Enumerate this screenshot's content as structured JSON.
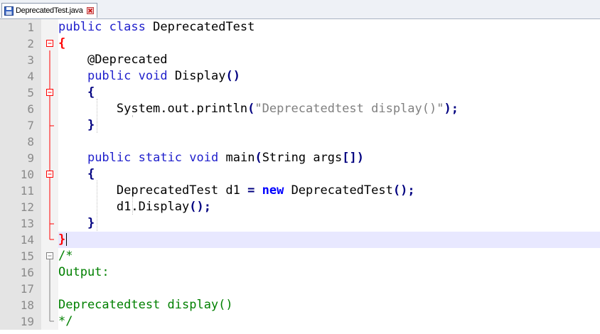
{
  "tab": {
    "label": "DeprecatedTest.java"
  },
  "lines": [
    {
      "num": "1",
      "tokens": [
        [
          "kw",
          "public"
        ],
        [
          "pl",
          " "
        ],
        [
          "kw",
          "class"
        ],
        [
          "pl",
          " DeprecatedTest"
        ]
      ]
    },
    {
      "num": "2",
      "tokens": [
        [
          "redbr",
          "{"
        ]
      ]
    },
    {
      "num": "3",
      "tokens": [
        [
          "pl",
          "    "
        ],
        [
          "ann",
          "@Deprecated"
        ]
      ]
    },
    {
      "num": "4",
      "tokens": [
        [
          "pl",
          "    "
        ],
        [
          "kw",
          "public"
        ],
        [
          "pl",
          " "
        ],
        [
          "kw",
          "void"
        ],
        [
          "pl",
          " Display"
        ],
        [
          "op",
          "()"
        ]
      ]
    },
    {
      "num": "5",
      "tokens": [
        [
          "pl",
          "    "
        ],
        [
          "op",
          "{"
        ]
      ]
    },
    {
      "num": "6",
      "tokens": [
        [
          "pl",
          "        System.out.println"
        ],
        [
          "op",
          "("
        ],
        [
          "str",
          "\"Deprecatedtest display()\""
        ],
        [
          "op",
          ");"
        ]
      ]
    },
    {
      "num": "7",
      "tokens": [
        [
          "pl",
          "    "
        ],
        [
          "op",
          "}"
        ]
      ]
    },
    {
      "num": "8",
      "tokens": []
    },
    {
      "num": "9",
      "tokens": [
        [
          "pl",
          "    "
        ],
        [
          "kw",
          "public"
        ],
        [
          "pl",
          " "
        ],
        [
          "kw",
          "static"
        ],
        [
          "pl",
          " "
        ],
        [
          "kw",
          "void"
        ],
        [
          "pl",
          " main"
        ],
        [
          "op",
          "("
        ],
        [
          "pl",
          "String args"
        ],
        [
          "op",
          "[])"
        ]
      ]
    },
    {
      "num": "10",
      "tokens": [
        [
          "pl",
          "    "
        ],
        [
          "op",
          "{"
        ]
      ]
    },
    {
      "num": "11",
      "tokens": [
        [
          "pl",
          "        DeprecatedTest d1 "
        ],
        [
          "op",
          "="
        ],
        [
          "pl",
          " "
        ],
        [
          "kwb",
          "new"
        ],
        [
          "pl",
          " DeprecatedTest"
        ],
        [
          "op",
          "();"
        ]
      ]
    },
    {
      "num": "12",
      "tokens": [
        [
          "pl",
          "        d1.Display"
        ],
        [
          "op",
          "();"
        ]
      ]
    },
    {
      "num": "13",
      "tokens": [
        [
          "pl",
          "    "
        ],
        [
          "op",
          "}"
        ]
      ]
    },
    {
      "num": "14",
      "tokens": [
        [
          "redbr",
          "}"
        ]
      ]
    },
    {
      "num": "15",
      "tokens": [
        [
          "cm",
          "/*"
        ]
      ]
    },
    {
      "num": "16",
      "tokens": [
        [
          "cm",
          "Output:"
        ]
      ]
    },
    {
      "num": "17",
      "tokens": []
    },
    {
      "num": "18",
      "tokens": [
        [
          "cm",
          "Deprecatedtest display()"
        ]
      ]
    },
    {
      "num": "19",
      "tokens": [
        [
          "cm",
          "*/"
        ]
      ]
    }
  ],
  "current_line": 14,
  "colors": {
    "keyword": "#2020cc",
    "comment": "#008000",
    "string": "#808080",
    "brace_match": "#ff0000",
    "current_line_bg": "#e8e8ff"
  }
}
